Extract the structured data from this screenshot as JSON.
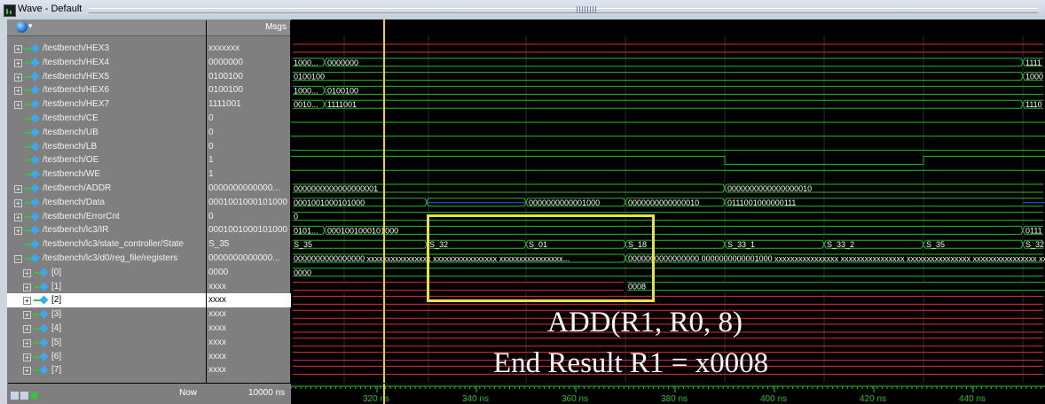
{
  "window": {
    "title": "Wave - Default"
  },
  "header": {
    "msgs_label": "Msgs"
  },
  "signals": [
    {
      "name": "/testbench/HEX3",
      "msg": "xxxxxxx",
      "expandable": true
    },
    {
      "name": "/testbench/HEX4",
      "msg": "0000000",
      "expandable": true
    },
    {
      "name": "/testbench/HEX5",
      "msg": "0100100",
      "expandable": true
    },
    {
      "name": "/testbench/HEX6",
      "msg": "0100100",
      "expandable": true
    },
    {
      "name": "/testbench/HEX7",
      "msg": "1111001",
      "expandable": true
    },
    {
      "name": "/testbench/CE",
      "msg": "0",
      "expandable": false
    },
    {
      "name": "/testbench/UB",
      "msg": "0",
      "expandable": false
    },
    {
      "name": "/testbench/LB",
      "msg": "0",
      "expandable": false
    },
    {
      "name": "/testbench/OE",
      "msg": "1",
      "expandable": false
    },
    {
      "name": "/testbench/WE",
      "msg": "1",
      "expandable": false
    },
    {
      "name": "/testbench/ADDR",
      "msg": "0000000000000...",
      "expandable": true
    },
    {
      "name": "/testbench/Data",
      "msg": "0001001000101000",
      "expandable": true
    },
    {
      "name": "/testbench/ErrorCnt",
      "msg": "0",
      "expandable": true
    },
    {
      "name": "/testbench/lc3/IR",
      "msg": "0001001000101000",
      "expandable": true
    },
    {
      "name": "/testbench/lc3/state_controller/State",
      "msg": "S_35",
      "expandable": false
    },
    {
      "name": "/testbench/lc3/d0/reg_file/registers",
      "msg": "0000000000000...",
      "expandable": true,
      "expanded": true
    },
    {
      "name": "[0]",
      "msg": "0000",
      "expandable": true,
      "indent": true
    },
    {
      "name": "[1]",
      "msg": "xxxx",
      "expandable": true,
      "indent": true
    },
    {
      "name": "[2]",
      "msg": "xxxx",
      "expandable": true,
      "indent": true,
      "selected": true
    },
    {
      "name": "[3]",
      "msg": "xxxx",
      "expandable": true,
      "indent": true
    },
    {
      "name": "[4]",
      "msg": "xxxx",
      "expandable": true,
      "indent": true
    },
    {
      "name": "[5]",
      "msg": "xxxx",
      "expandable": true,
      "indent": true
    },
    {
      "name": "[6]",
      "msg": "xxxx",
      "expandable": true,
      "indent": true
    },
    {
      "name": "[7]",
      "msg": "xxxx",
      "expandable": true,
      "indent": true
    }
  ],
  "bus_values": {
    "hex4": [
      "1000...",
      "0000000",
      "1111"
    ],
    "hex5": [
      "0100100",
      "1000"
    ],
    "hex6": [
      "1000...",
      "0100100"
    ],
    "hex7": [
      "0010...",
      "1111001",
      "1110"
    ],
    "addr": [
      "0000000000000000001",
      "0000000000000000010"
    ],
    "data": [
      "0001001000101000",
      "0000000000001000",
      "0000000000000010",
      "0111001000000111"
    ],
    "errorcnt": [
      "0"
    ],
    "ir": [
      "0101...",
      "0001001000101000",
      "0111"
    ],
    "state": [
      "S_35",
      "S_32",
      "S_01",
      "S_18",
      "S_33_1",
      "S_33_2",
      "S_35",
      "S_32"
    ],
    "registers": [
      "0000000000000000 xxxxxxxxxxxxxxxx xxxxxxxxxxxxxxxx xxxxxxxxxxxxxxxx...",
      "0000000000000000 0000000000001000 xxxxxxxxxxxxxxxx xxxxxxxxxxxxxxxx xxxxxxxxxxxxxxxx xxxxxxxxxxxxxxxx xx"
    ],
    "reg0": [
      "0000"
    ],
    "reg1": [
      "0008"
    ]
  },
  "status": {
    "now_label": "Now",
    "now_value": "10000 ns"
  },
  "timeline": {
    "ticks": [
      "320 ns",
      "340 ns",
      "360 ns",
      "380 ns",
      "400 ns",
      "420 ns",
      "440 ns"
    ]
  },
  "annotation": {
    "line1": "ADD(R1, R0, 8)",
    "line2": "End Result R1 = x0008"
  },
  "colors": {
    "wave_green": "#21c121",
    "x_red": "#e03030",
    "cursor": "#f5d21f",
    "highlight": "#f0e040",
    "bus_blue": "#3060ff"
  }
}
